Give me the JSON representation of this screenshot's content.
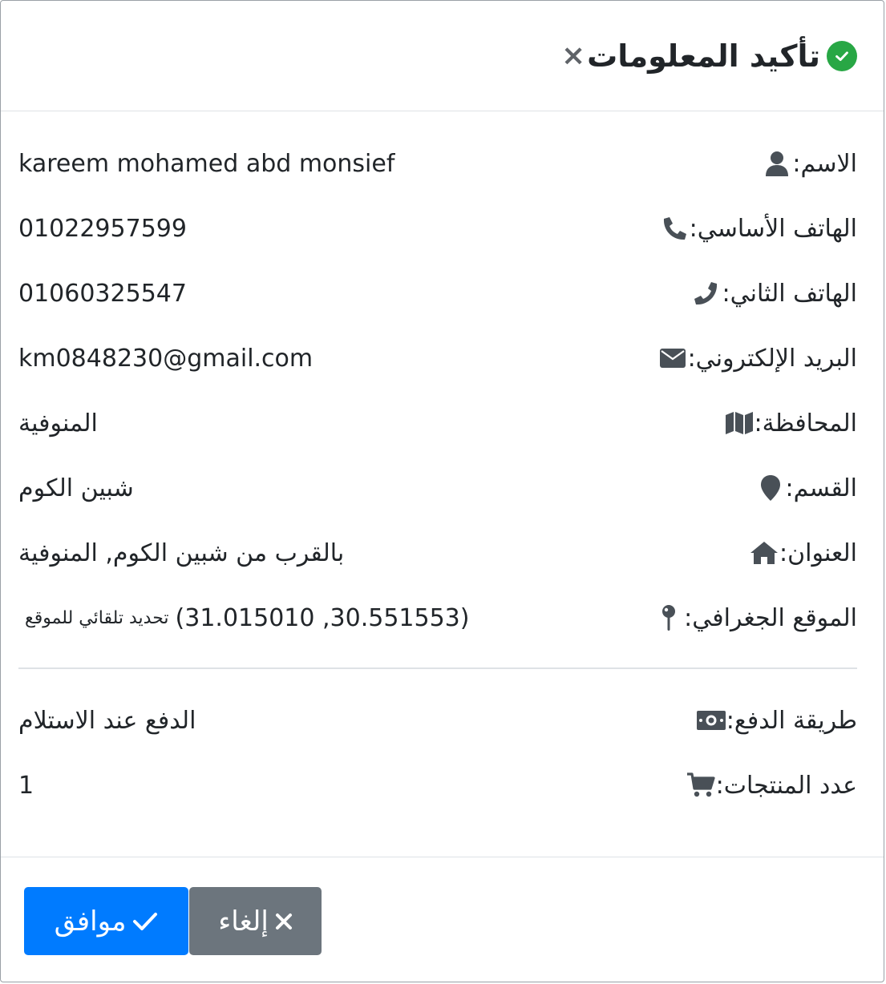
{
  "header": {
    "title": "تأكيد المعلومات",
    "title_icon": "check-circle-icon",
    "close_label": "×"
  },
  "fields": {
    "name": {
      "label": "الاسم:",
      "value": "kareem mohamed abd monsief",
      "icon": "user-icon"
    },
    "phone_primary": {
      "label": "الهاتف الأساسي:",
      "value": "01022957599",
      "icon": "phone-icon"
    },
    "phone_secondary": {
      "label": "الهاتف الثاني:",
      "value": "01060325547",
      "icon": "phone-alt-icon"
    },
    "email": {
      "label": "البريد الإلكتروني:",
      "value": "km0848230@gmail.com",
      "icon": "envelope-icon"
    },
    "governorate": {
      "label": "المحافظة:",
      "value": "المنوفية",
      "icon": "map-icon"
    },
    "district": {
      "label": "القسم:",
      "value": "شبين الكوم",
      "icon": "map-marker-icon"
    },
    "address": {
      "label": "العنوان:",
      "value": "بالقرب من شبين الكوم, المنوفية",
      "icon": "home-icon"
    },
    "geo": {
      "label": "الموقع الجغرافي:",
      "value": "(31.015010 ,30.551553)",
      "note": "تحديد تلقائي للموقع",
      "icon": "map-pin-icon"
    },
    "payment": {
      "label": "طريقة الدفع:",
      "value": "الدفع عند الاستلام",
      "icon": "money-bill-icon"
    },
    "items_count": {
      "label": "عدد المنتجات:",
      "value": "1",
      "icon": "shopping-cart-icon"
    }
  },
  "footer": {
    "ok_label": "موافق",
    "cancel_label": "إلغاء"
  },
  "colors": {
    "ok": "#007bff",
    "cancel": "#6c757d",
    "success": "#28a745",
    "icon": "#495057"
  }
}
